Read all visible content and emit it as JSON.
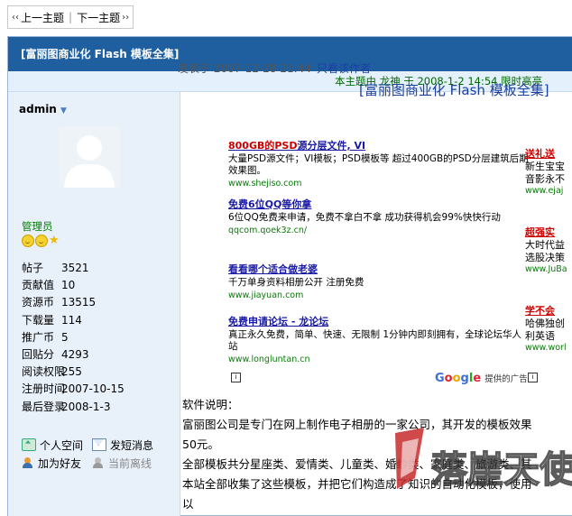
{
  "topnav": {
    "prev": "上一主题",
    "next": "下一主题",
    "prev_arrow": "‹‹",
    "next_arrow": "››"
  },
  "thread": {
    "title": "[富丽图商业化 Flash 模板全集]"
  },
  "info": {
    "label": "本主题由",
    "author": "龙神",
    "mid": "于",
    "date": "2008-1-2 14:54",
    "action": "限时高亮"
  },
  "user": {
    "name": "admin",
    "role": "管理员",
    "stats": [
      {
        "k": "帖子",
        "v": "3521"
      },
      {
        "k": "贡献值",
        "v": "10"
      },
      {
        "k": "资源币",
        "v": "13515"
      },
      {
        "k": "下载量",
        "v": "114"
      },
      {
        "k": "推广币",
        "v": "5"
      },
      {
        "k": "回贴分",
        "v": "4293"
      },
      {
        "k": "阅读权限",
        "v": "255"
      },
      {
        "k": "注册时间",
        "v": "2007-10-15"
      },
      {
        "k": "最后登录",
        "v": "2008-1-3"
      }
    ],
    "actions": {
      "space": "个人空间",
      "msg": "发短消息",
      "friend": "加为好友",
      "status": "当前离线"
    }
  },
  "post": {
    "meta": "发表于 2007-12-28 21:44",
    "only_author": "只看该作者",
    "ad_title": "[富丽图商业化 Flash 模板全集]",
    "ads": [
      {
        "title_hl": "800GB的PSD",
        "title_rest": "源分层文件, VI",
        "desc": "大量PSD源文件；VI模板；PSD模板等 超过400GB的PSD分层建筑后期效果图。",
        "url": "www.shejiso.com"
      },
      {
        "title_hl": "",
        "title_rest": "免费6位QQ等你拿",
        "desc": "6位QQ免费来申请，免费不拿白不拿 成功获得机会99%快快行动",
        "url": "qqcom.qoek3z.cn/"
      },
      {
        "title_hl": "",
        "title_rest": "看看哪个适合做老婆",
        "desc": "千万单身资料相册公开 注册免费",
        "url": "www.jiayuan.com"
      },
      {
        "title_hl": "",
        "title_rest": "免费申请论坛 - 龙论坛",
        "desc": "真正永久免费，简单、快速、无限制 1分钟内即刻拥有，全球论坛华人站",
        "url": "www.longluntan.cn"
      }
    ],
    "right_ads": [
      {
        "title": "送礼送",
        "d1": "新生宝宝",
        "d2": "音影永不",
        "url": "www.ejaj"
      },
      {
        "title": "超强实",
        "d1": "大时代益",
        "d2": "选股决策",
        "url": "www.JuBa"
      },
      {
        "title": "学不会",
        "d1": "哈佛独创",
        "d2": "利英语",
        "url": "www.worl"
      }
    ],
    "google": {
      "g": "G",
      "o1": "o",
      "o2": "o",
      "g2": "g",
      "l": "l",
      "e": "e",
      "sub": "提供的广告"
    },
    "body": [
      "软件说明：",
      "富丽图公司是专门在网上制作电子相册的一家公司，其开发的模板效果",
      "50元。",
      "全部模板共分星座类、爱情类、儿童类、婚纱类、家庭类、旅游类、其",
      "本站全部收集了这些模板，并把它们构造成了知识的自动化模板，使用",
      "以"
    ],
    "watermark": "落崖天使"
  }
}
